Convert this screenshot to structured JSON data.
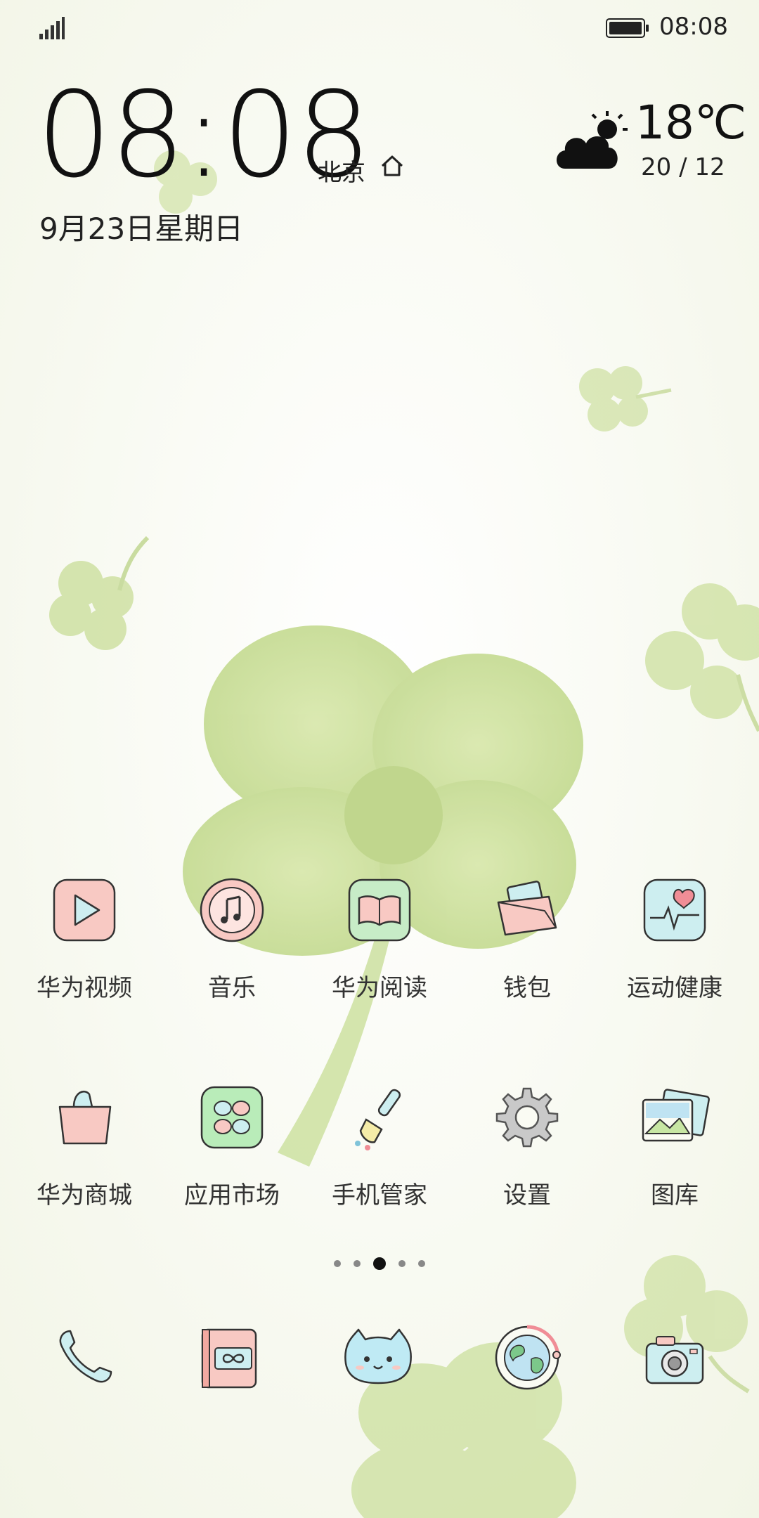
{
  "status_bar": {
    "time": "08:08",
    "signal_icon": "signal-bars-icon",
    "battery_icon": "battery-full-icon"
  },
  "clock_widget": {
    "time": "08:08",
    "city": "北京",
    "date": "9月23日星期日",
    "temperature": "18℃",
    "temp_range": "20 / 12",
    "weather_icon": "cloud-sun-icon"
  },
  "home_grid": {
    "row1": [
      {
        "label": "华为视频",
        "icon": "video-play-icon"
      },
      {
        "label": "音乐",
        "icon": "music-note-icon"
      },
      {
        "label": "华为阅读",
        "icon": "open-book-icon"
      },
      {
        "label": "钱包",
        "icon": "wallet-icon"
      },
      {
        "label": "运动健康",
        "icon": "heart-pulse-icon"
      }
    ],
    "row2": [
      {
        "label": "华为商城",
        "icon": "shopping-bag-icon"
      },
      {
        "label": "应用市场",
        "icon": "app-store-icon"
      },
      {
        "label": "手机管家",
        "icon": "brush-icon"
      },
      {
        "label": "设置",
        "icon": "gear-icon"
      },
      {
        "label": "图库",
        "icon": "gallery-icon"
      }
    ]
  },
  "page_indicator": {
    "total": 5,
    "active": 3
  },
  "dock": [
    {
      "icon": "phone-icon"
    },
    {
      "icon": "contacts-icon"
    },
    {
      "icon": "cat-messages-icon"
    },
    {
      "icon": "browser-globe-icon"
    },
    {
      "icon": "camera-icon"
    }
  ],
  "colors": {
    "background": "#fafbf3",
    "clover": "#c7dc8f",
    "clover_dark": "#a9c46f",
    "pink": "#f8c9c3",
    "mint": "#cdeef0"
  }
}
